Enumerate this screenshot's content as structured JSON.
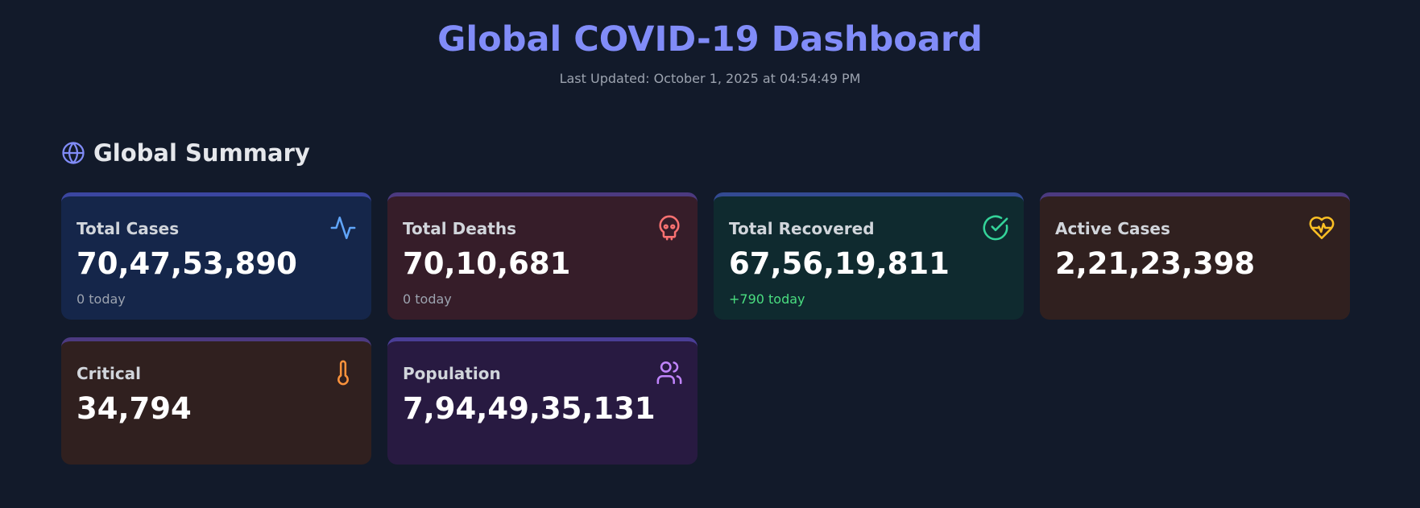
{
  "header": {
    "title": "Global COVID-19 Dashboard",
    "last_updated": "Last Updated: October 1, 2025 at 04:54:49 PM"
  },
  "section": {
    "icon": "globe-icon",
    "title": "Global Summary"
  },
  "cards": [
    {
      "label": "Total Cases",
      "value": "70,47,53,890",
      "delta": "0 today",
      "icon": "activity-icon",
      "color": "#60a5fa"
    },
    {
      "label": "Total Deaths",
      "value": "70,10,681",
      "delta": "0 today",
      "icon": "skull-icon",
      "color": "#f87171"
    },
    {
      "label": "Total Recovered",
      "value": "67,56,19,811",
      "delta": "+790 today",
      "icon": "check-circle-icon",
      "color": "#34d399"
    },
    {
      "label": "Active Cases",
      "value": "2,21,23,398",
      "delta": "",
      "icon": "heart-pulse-icon",
      "color": "#fbbf24"
    },
    {
      "label": "Critical",
      "value": "34,794",
      "delta": "",
      "icon": "thermometer-icon",
      "color": "#fb923c"
    },
    {
      "label": "Population",
      "value": "7,94,49,35,131",
      "delta": "",
      "icon": "users-icon",
      "color": "#c084fc"
    }
  ]
}
